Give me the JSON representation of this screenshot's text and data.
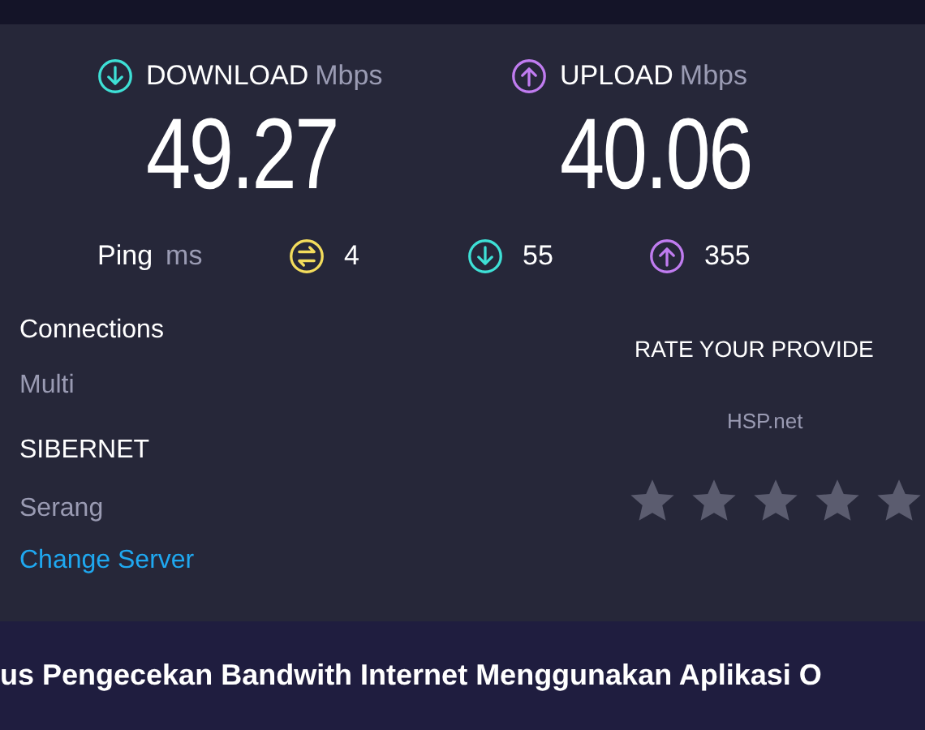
{
  "download": {
    "label": "DOWNLOAD",
    "unit": "Mbps",
    "value": "49.27"
  },
  "upload": {
    "label": "UPLOAD",
    "unit": "Mbps",
    "value": "40.06"
  },
  "ping": {
    "label": "Ping",
    "unit": "ms",
    "items": [
      {
        "kind": "idle",
        "value": "4"
      },
      {
        "kind": "download",
        "value": "55"
      },
      {
        "kind": "upload",
        "value": "355"
      }
    ]
  },
  "connections": {
    "label": "Connections",
    "value": "Multi"
  },
  "server": {
    "name": "SIBERNET",
    "location": "Serang",
    "link": "Change Server"
  },
  "rating": {
    "title": "RATE YOUR PROVIDE",
    "provider": "HSP.net",
    "stars": 0
  },
  "caption": "us Pengecekan Bandwith Internet Menggunakan Aplikasi O"
}
